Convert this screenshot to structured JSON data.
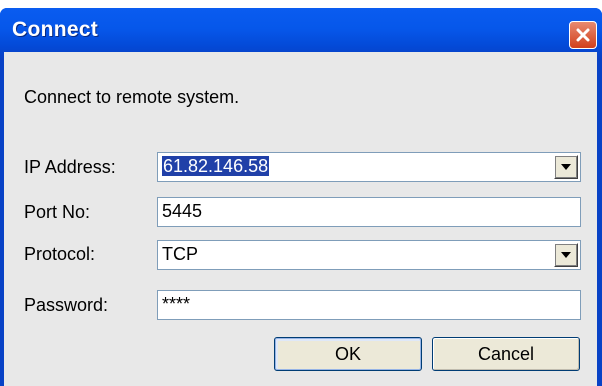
{
  "window": {
    "title": "Connect",
    "close_icon": "close-icon"
  },
  "dialog": {
    "intro": "Connect to remote system.",
    "ip": {
      "label": "IP Address:",
      "value": "61.82.146.58",
      "selected": true
    },
    "port": {
      "label": "Port No:",
      "value": "5445"
    },
    "protocol": {
      "label": "Protocol:",
      "value": "TCP"
    },
    "password": {
      "label": "Password:",
      "value": "****"
    },
    "ok_label": "OK",
    "cancel_label": "Cancel"
  },
  "colors": {
    "titlebar": "#0657ea",
    "client": "#e8e8e8",
    "selection": "#2040a8",
    "close_button": "#d2401c"
  }
}
